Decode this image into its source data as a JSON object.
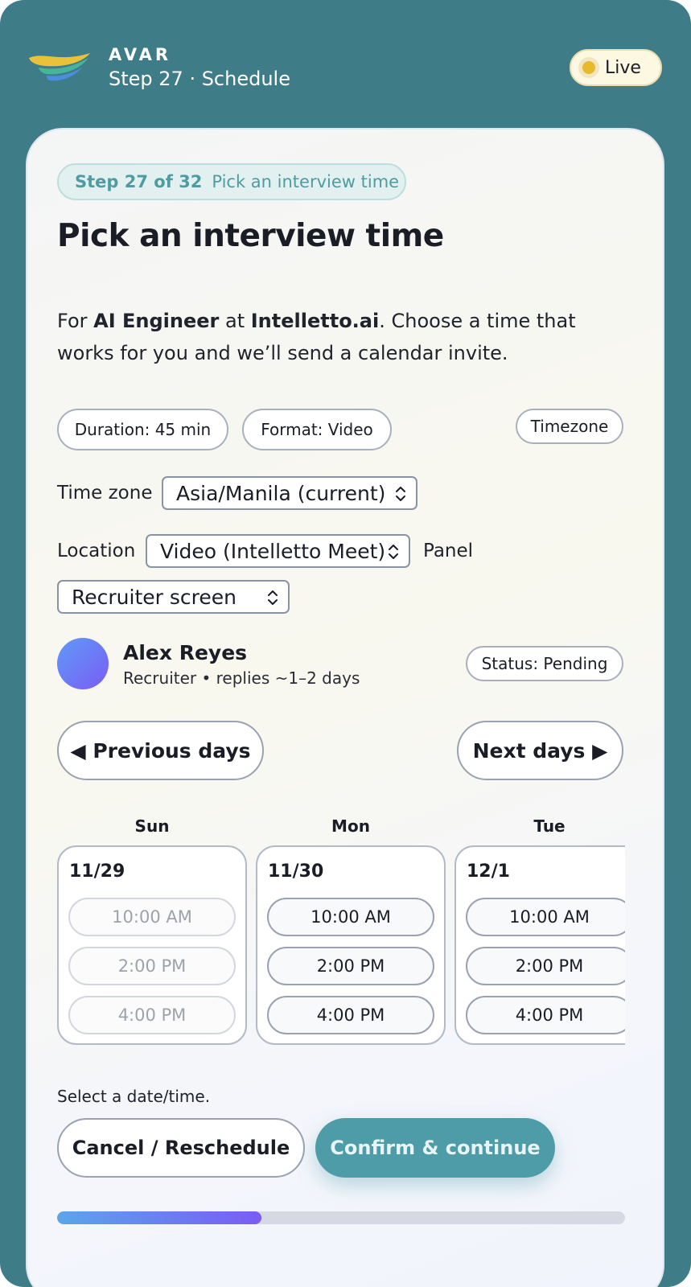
{
  "header": {
    "brand": "AVAR",
    "subtitle": "Step 27 · Schedule",
    "live_label": "Live"
  },
  "step": {
    "badge_strong": "Step 27 of 32",
    "badge_text": "Pick an interview time",
    "title": "Pick an interview time",
    "desc_prefix": "For ",
    "role": "AI Engineer",
    "desc_at": " at ",
    "company": "Intelletto.ai",
    "desc_suffix": ". Choose a time that works for you and we’ll send a calendar invite."
  },
  "chips": {
    "duration": "Duration: 45 min",
    "format": "Format: Video",
    "timezone": "Timezone"
  },
  "fields": {
    "timezone_label": "Time zone",
    "timezone_value": "Asia/Manila (current)",
    "location_label": "Location",
    "location_value": "Video (Intelletto Meet)",
    "panel_label": "Panel",
    "panel_value": "Recruiter screen"
  },
  "recruiter": {
    "name": "Alex Reyes",
    "role": "Recruiter • replies ~1–2 days",
    "status": "Status: Pending"
  },
  "nav": {
    "prev": "◀ Previous days",
    "next": "Next days ▶"
  },
  "days": [
    {
      "name": "Sun",
      "date": "11/29",
      "slots": [
        "10:00 AM",
        "2:00 PM",
        "4:00 PM"
      ],
      "disabled": true
    },
    {
      "name": "Mon",
      "date": "11/30",
      "slots": [
        "10:00 AM",
        "2:00 PM",
        "4:00 PM"
      ],
      "disabled": false
    },
    {
      "name": "Tue",
      "date": "12/1",
      "slots": [
        "10:00 AM",
        "2:00 PM",
        "4:00 PM"
      ],
      "disabled": false
    }
  ],
  "footer": {
    "hint": "Select a date/time.",
    "cancel": "Cancel / Reschedule",
    "confirm": "Confirm & continue",
    "progress": 0.36
  },
  "colors": {
    "frame": "#3e7d88",
    "accent": "#4e9ca8",
    "progress_start": "#5aa6ea",
    "progress_end": "#7a5cf5",
    "live_dot": "#e8b92b"
  }
}
